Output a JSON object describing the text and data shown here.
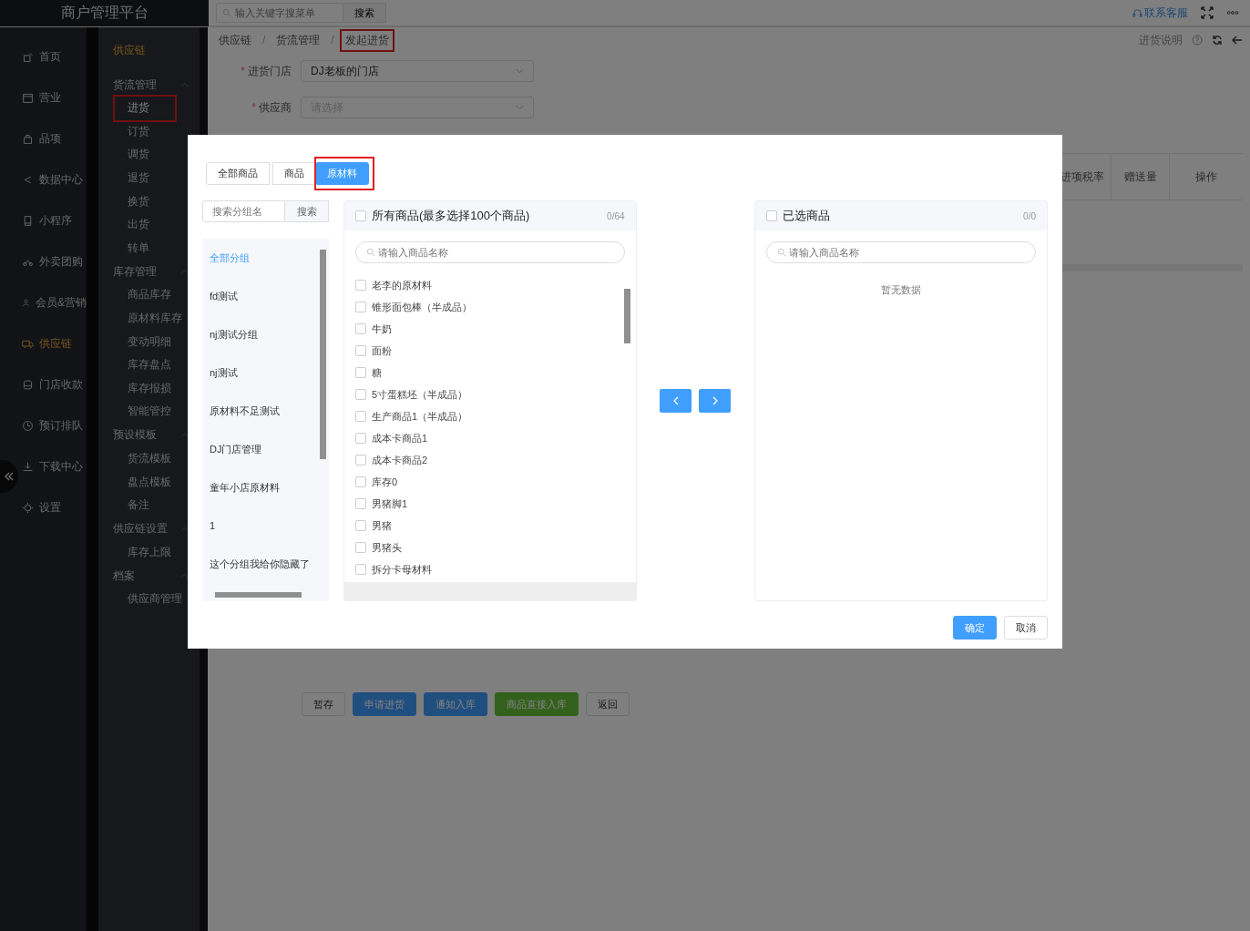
{
  "app": {
    "title": "商户管理平台",
    "menu_search": {
      "placeholder": "输入关键字搜菜单",
      "button": "搜索"
    },
    "support": "联系客服"
  },
  "nav": [
    {
      "label": "首页",
      "selected": false
    },
    {
      "label": "营业",
      "selected": false
    },
    {
      "label": "品项",
      "selected": false
    },
    {
      "label": "数据中心",
      "selected": false
    },
    {
      "label": "小程序",
      "selected": false
    },
    {
      "label": "外卖团购",
      "selected": false
    },
    {
      "label": "会员&营销",
      "selected": false
    },
    {
      "label": "供应链",
      "selected": true
    },
    {
      "label": "门店收款",
      "selected": false
    },
    {
      "label": "预订排队",
      "selected": false
    },
    {
      "label": "下载中心",
      "selected": false
    },
    {
      "label": "设置",
      "selected": false
    }
  ],
  "subnav": {
    "title": "供应链",
    "groups": [
      {
        "label": "货流管理",
        "expanded": true,
        "children": [
          {
            "label": "进货",
            "selected": true,
            "annotated": true
          },
          {
            "label": "订货",
            "selected": false,
            "annotated": false
          },
          {
            "label": "调货",
            "selected": false,
            "annotated": false
          },
          {
            "label": "退货",
            "selected": false,
            "annotated": false
          },
          {
            "label": "换货",
            "selected": false,
            "annotated": false
          },
          {
            "label": "出货",
            "selected": false,
            "annotated": false
          },
          {
            "label": "转单",
            "selected": false,
            "annotated": false
          }
        ]
      },
      {
        "label": "库存管理",
        "expanded": true,
        "children": [
          {
            "label": "商品库存",
            "selected": false,
            "annotated": false
          },
          {
            "label": "原材料库存",
            "selected": false,
            "annotated": false
          },
          {
            "label": "变动明细",
            "selected": false,
            "annotated": false
          },
          {
            "label": "库存盘点",
            "selected": false,
            "annotated": false
          },
          {
            "label": "库存报损",
            "selected": false,
            "annotated": false
          },
          {
            "label": "智能管控",
            "selected": false,
            "annotated": false
          }
        ]
      },
      {
        "label": "预设模板",
        "expanded": true,
        "children": [
          {
            "label": "货流模板",
            "selected": false,
            "annotated": false
          },
          {
            "label": "盘点模板",
            "selected": false,
            "annotated": false
          },
          {
            "label": "备注",
            "selected": false,
            "annotated": false
          }
        ]
      },
      {
        "label": "供应链设置",
        "expanded": true,
        "children": [
          {
            "label": "库存上限",
            "selected": false,
            "annotated": false
          }
        ]
      },
      {
        "label": "档案",
        "expanded": true,
        "children": [
          {
            "label": "供应商管理",
            "selected": false,
            "annotated": false
          }
        ]
      }
    ]
  },
  "breadcrumb": {
    "separator": "/",
    "items": [
      {
        "label": "供应链",
        "annotated": false
      },
      {
        "label": "货流管理",
        "annotated": false
      },
      {
        "label": "发起进货",
        "annotated": true
      }
    ]
  },
  "page_help": "进货说明",
  "form": [
    {
      "mark": "*",
      "label": "进货门店",
      "value": "DJ老板的门店"
    },
    {
      "mark": "*",
      "label": "供应商",
      "placeholder": "请选择"
    }
  ],
  "table": {
    "columns": [
      "进项税率",
      "赠送量",
      "操作"
    ]
  },
  "footer_buttons": [
    {
      "label": "暂存",
      "kind": "default"
    },
    {
      "label": "申请进货",
      "kind": "primary"
    },
    {
      "label": "通知入库",
      "kind": "primary"
    },
    {
      "label": "商品直接入库",
      "kind": "success"
    },
    {
      "label": "返回",
      "kind": "default"
    }
  ],
  "dialog": {
    "tabs": [
      {
        "label": "全部商品",
        "selected": false,
        "annotated": false
      },
      {
        "label": "商品",
        "selected": false,
        "annotated": false
      },
      {
        "label": "原材料",
        "selected": true,
        "annotated": true
      }
    ],
    "group_search": {
      "placeholder": "搜索分组名",
      "button": "搜索"
    },
    "groups": [
      {
        "label": "全部分组",
        "selected": true
      },
      {
        "label": "fd测试",
        "selected": false
      },
      {
        "label": "nj测试分组",
        "selected": false
      },
      {
        "label": "nj测试",
        "selected": false
      },
      {
        "label": "原材料不足测试",
        "selected": false
      },
      {
        "label": "DJ门店管理",
        "selected": false
      },
      {
        "label": "童年小店原材料",
        "selected": false
      },
      {
        "label": "1",
        "selected": false
      },
      {
        "label": "这个分组我给你隐藏了",
        "selected": false
      }
    ],
    "source": {
      "title": "所有商品(最多选择100个商品)",
      "count": "0/64",
      "checked": false,
      "placeholder": "请输入商品名称",
      "items": [
        {
          "label": "老李的原材料",
          "checked": false
        },
        {
          "label": "锥形面包棒（半成品）",
          "checked": false
        },
        {
          "label": "牛奶",
          "checked": false
        },
        {
          "label": "面粉",
          "checked": false
        },
        {
          "label": "糖",
          "checked": false
        },
        {
          "label": "5寸蛋糕坯（半成品）",
          "checked": false
        },
        {
          "label": "生产商品1（半成品）",
          "checked": false
        },
        {
          "label": "成本卡商品1",
          "checked": false
        },
        {
          "label": "成本卡商品2",
          "checked": false
        },
        {
          "label": "库存0",
          "checked": false
        },
        {
          "label": "男猪脚1",
          "checked": false
        },
        {
          "label": "男猪",
          "checked": false
        },
        {
          "label": "男猪头",
          "checked": false
        },
        {
          "label": "拆分卡母材料",
          "checked": false
        }
      ]
    },
    "target": {
      "title": "已选商品",
      "count": "0/0",
      "checked": false,
      "placeholder": "请输入商品名称",
      "empty": "暂无数据"
    },
    "buttons": [
      {
        "label": "确定",
        "kind": "primary"
      },
      {
        "label": "取消",
        "kind": "default"
      }
    ]
  }
}
